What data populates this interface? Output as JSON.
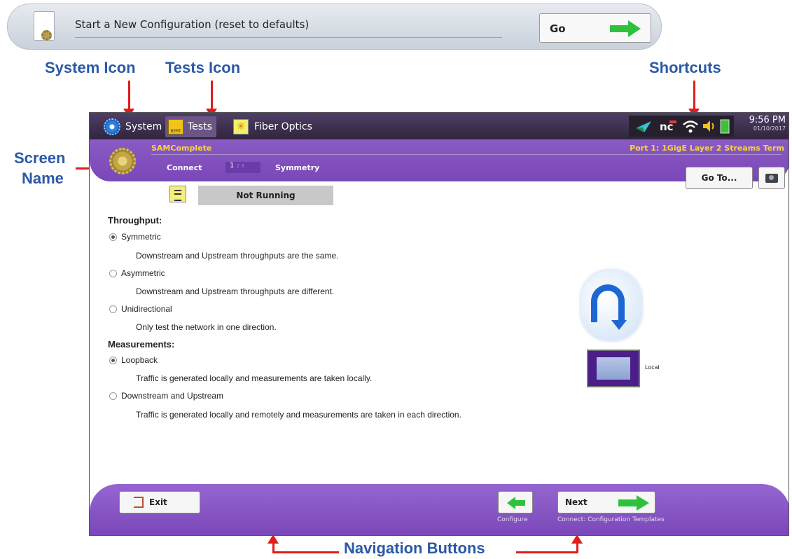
{
  "config_bar": {
    "text": "Start a New Configuration (reset to defaults)",
    "go_label": "Go"
  },
  "annotations": {
    "system_icon": "System Icon",
    "tests_icon": "Tests Icon",
    "shortcuts": "Shortcuts",
    "screen_line1": "Screen",
    "screen_line2": "Name",
    "navigation": "Navigation Buttons"
  },
  "topbar": {
    "tabs": [
      {
        "label": "System",
        "icon": "gear-icon"
      },
      {
        "label": "Tests",
        "icon": "bert-icon"
      },
      {
        "label": "Fiber Optics",
        "icon": "fiber-icon"
      }
    ],
    "time": "9:56 PM",
    "date": "01/10/2017",
    "shortcut_icons": [
      "plane-icon",
      "nc-icon",
      "wifi-icon",
      "speaker-icon",
      "battery-icon"
    ]
  },
  "header": {
    "app_name": "SAMComplete",
    "port": "Port 1: 1GigE Layer 2 Streams Term",
    "step_label": "Connect",
    "step_current": "1",
    "step_others": "2 3",
    "section": "Symmetry",
    "goto_label": "Go To...",
    "status": "Not Running"
  },
  "content": {
    "throughput_label": "Throughput:",
    "options": [
      {
        "label": "Symmetric",
        "desc": "Downstream and Upstream throughputs are the same.",
        "selected": true
      },
      {
        "label": "Asymmetric",
        "desc": "Downstream and Upstream throughputs are different.",
        "selected": false
      },
      {
        "label": "Unidirectional",
        "desc": "Only test the network in one direction.",
        "selected": false
      }
    ],
    "measurements_label": "Measurements:",
    "measurements": [
      {
        "label": "Loopback",
        "desc": "Traffic is generated locally and measurements are taken locally.",
        "selected": true
      },
      {
        "label": "Downstream and Upstream",
        "desc": "Traffic is generated locally and remotely and measurements are taken in each direction.",
        "selected": false
      }
    ],
    "local_label": "Local"
  },
  "footer": {
    "exit_label": "Exit",
    "configure_caption": "Configure",
    "next_label": "Next",
    "next_caption": "Connect: Configuration Templates"
  },
  "colors": {
    "accent_purple": "#7a47b8",
    "annotation_blue": "#2b59a8",
    "annotation_red": "#e01d1d",
    "arrow_green": "#2fc13b"
  }
}
